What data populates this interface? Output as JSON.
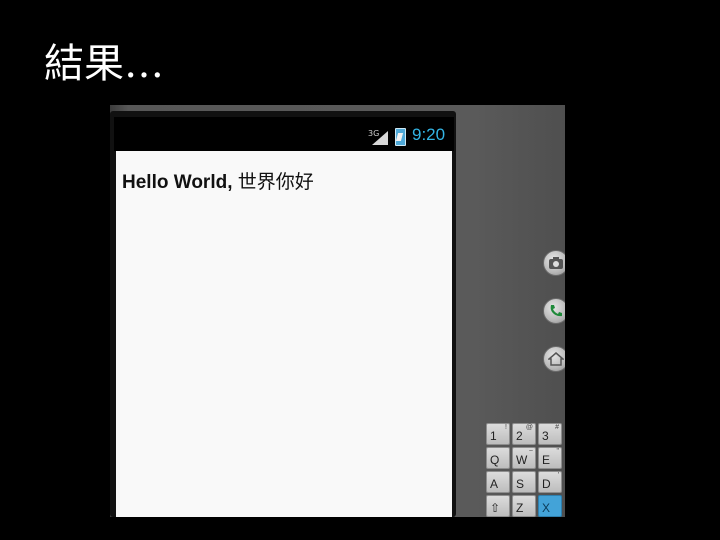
{
  "slide": {
    "title": "結果…"
  },
  "status_bar": {
    "network": "3G",
    "time": "9:20"
  },
  "app": {
    "hello_bold": "Hello World,",
    "hello_rest": " 世界你好"
  },
  "keyboard": {
    "rows": [
      [
        {
          "main": "1",
          "alt": "!"
        },
        {
          "main": "2",
          "alt": "@"
        },
        {
          "main": "3",
          "alt": "#"
        }
      ],
      [
        {
          "main": "Q",
          "alt": ""
        },
        {
          "main": "W",
          "alt": "~"
        },
        {
          "main": "E",
          "alt": "\""
        }
      ],
      [
        {
          "main": "A",
          "alt": ""
        },
        {
          "main": "S",
          "alt": ""
        },
        {
          "main": "D",
          "alt": "'"
        }
      ],
      [
        {
          "main": "⇧",
          "alt": ""
        },
        {
          "main": "Z",
          "alt": ""
        },
        {
          "main": "X",
          "alt": ""
        }
      ]
    ]
  },
  "side_buttons": [
    "camera-icon",
    "phone-icon",
    "home-icon"
  ],
  "colors": {
    "clock": "#33b5e5",
    "selected_key": "#43a3d8"
  }
}
